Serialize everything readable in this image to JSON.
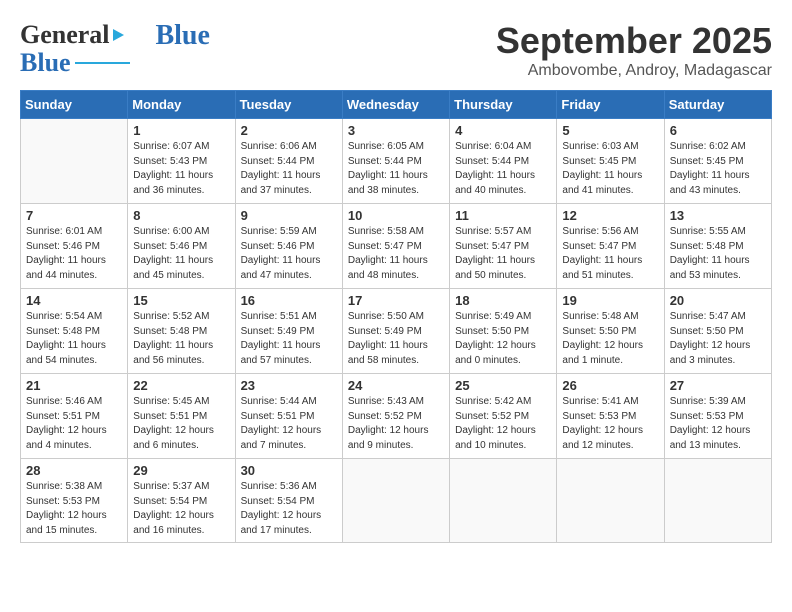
{
  "header": {
    "logo": {
      "part1": "General",
      "part2": "Blue"
    },
    "title": "September 2025",
    "subtitle": "Ambovombe, Androy, Madagascar"
  },
  "calendar": {
    "days_of_week": [
      "Sunday",
      "Monday",
      "Tuesday",
      "Wednesday",
      "Thursday",
      "Friday",
      "Saturday"
    ],
    "weeks": [
      [
        {
          "day": "",
          "info": ""
        },
        {
          "day": "1",
          "info": "Sunrise: 6:07 AM\nSunset: 5:43 PM\nDaylight: 11 hours\nand 36 minutes."
        },
        {
          "day": "2",
          "info": "Sunrise: 6:06 AM\nSunset: 5:44 PM\nDaylight: 11 hours\nand 37 minutes."
        },
        {
          "day": "3",
          "info": "Sunrise: 6:05 AM\nSunset: 5:44 PM\nDaylight: 11 hours\nand 38 minutes."
        },
        {
          "day": "4",
          "info": "Sunrise: 6:04 AM\nSunset: 5:44 PM\nDaylight: 11 hours\nand 40 minutes."
        },
        {
          "day": "5",
          "info": "Sunrise: 6:03 AM\nSunset: 5:45 PM\nDaylight: 11 hours\nand 41 minutes."
        },
        {
          "day": "6",
          "info": "Sunrise: 6:02 AM\nSunset: 5:45 PM\nDaylight: 11 hours\nand 43 minutes."
        }
      ],
      [
        {
          "day": "7",
          "info": "Sunrise: 6:01 AM\nSunset: 5:46 PM\nDaylight: 11 hours\nand 44 minutes."
        },
        {
          "day": "8",
          "info": "Sunrise: 6:00 AM\nSunset: 5:46 PM\nDaylight: 11 hours\nand 45 minutes."
        },
        {
          "day": "9",
          "info": "Sunrise: 5:59 AM\nSunset: 5:46 PM\nDaylight: 11 hours\nand 47 minutes."
        },
        {
          "day": "10",
          "info": "Sunrise: 5:58 AM\nSunset: 5:47 PM\nDaylight: 11 hours\nand 48 minutes."
        },
        {
          "day": "11",
          "info": "Sunrise: 5:57 AM\nSunset: 5:47 PM\nDaylight: 11 hours\nand 50 minutes."
        },
        {
          "day": "12",
          "info": "Sunrise: 5:56 AM\nSunset: 5:47 PM\nDaylight: 11 hours\nand 51 minutes."
        },
        {
          "day": "13",
          "info": "Sunrise: 5:55 AM\nSunset: 5:48 PM\nDaylight: 11 hours\nand 53 minutes."
        }
      ],
      [
        {
          "day": "14",
          "info": "Sunrise: 5:54 AM\nSunset: 5:48 PM\nDaylight: 11 hours\nand 54 minutes."
        },
        {
          "day": "15",
          "info": "Sunrise: 5:52 AM\nSunset: 5:48 PM\nDaylight: 11 hours\nand 56 minutes."
        },
        {
          "day": "16",
          "info": "Sunrise: 5:51 AM\nSunset: 5:49 PM\nDaylight: 11 hours\nand 57 minutes."
        },
        {
          "day": "17",
          "info": "Sunrise: 5:50 AM\nSunset: 5:49 PM\nDaylight: 11 hours\nand 58 minutes."
        },
        {
          "day": "18",
          "info": "Sunrise: 5:49 AM\nSunset: 5:50 PM\nDaylight: 12 hours\nand 0 minutes."
        },
        {
          "day": "19",
          "info": "Sunrise: 5:48 AM\nSunset: 5:50 PM\nDaylight: 12 hours\nand 1 minute."
        },
        {
          "day": "20",
          "info": "Sunrise: 5:47 AM\nSunset: 5:50 PM\nDaylight: 12 hours\nand 3 minutes."
        }
      ],
      [
        {
          "day": "21",
          "info": "Sunrise: 5:46 AM\nSunset: 5:51 PM\nDaylight: 12 hours\nand 4 minutes."
        },
        {
          "day": "22",
          "info": "Sunrise: 5:45 AM\nSunset: 5:51 PM\nDaylight: 12 hours\nand 6 minutes."
        },
        {
          "day": "23",
          "info": "Sunrise: 5:44 AM\nSunset: 5:51 PM\nDaylight: 12 hours\nand 7 minutes."
        },
        {
          "day": "24",
          "info": "Sunrise: 5:43 AM\nSunset: 5:52 PM\nDaylight: 12 hours\nand 9 minutes."
        },
        {
          "day": "25",
          "info": "Sunrise: 5:42 AM\nSunset: 5:52 PM\nDaylight: 12 hours\nand 10 minutes."
        },
        {
          "day": "26",
          "info": "Sunrise: 5:41 AM\nSunset: 5:53 PM\nDaylight: 12 hours\nand 12 minutes."
        },
        {
          "day": "27",
          "info": "Sunrise: 5:39 AM\nSunset: 5:53 PM\nDaylight: 12 hours\nand 13 minutes."
        }
      ],
      [
        {
          "day": "28",
          "info": "Sunrise: 5:38 AM\nSunset: 5:53 PM\nDaylight: 12 hours\nand 15 minutes."
        },
        {
          "day": "29",
          "info": "Sunrise: 5:37 AM\nSunset: 5:54 PM\nDaylight: 12 hours\nand 16 minutes."
        },
        {
          "day": "30",
          "info": "Sunrise: 5:36 AM\nSunset: 5:54 PM\nDaylight: 12 hours\nand 17 minutes."
        },
        {
          "day": "",
          "info": ""
        },
        {
          "day": "",
          "info": ""
        },
        {
          "day": "",
          "info": ""
        },
        {
          "day": "",
          "info": ""
        }
      ]
    ]
  }
}
